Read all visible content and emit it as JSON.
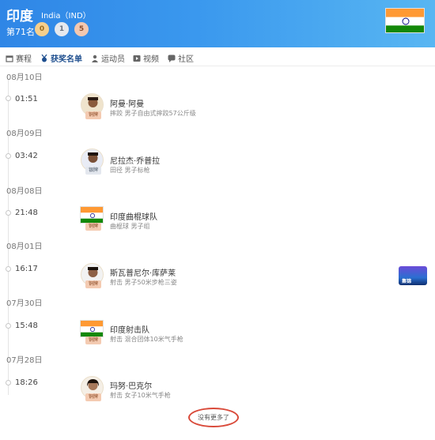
{
  "header": {
    "country_name": "印度",
    "country_code": "India（IND）",
    "rank": "第71名",
    "gold": "0",
    "silver": "1",
    "bronze": "5",
    "flag_colors": [
      "#ff9933",
      "#ffffff",
      "#138808"
    ]
  },
  "tabs": [
    {
      "label": "赛程",
      "icon": "calendar-icon"
    },
    {
      "label": "获奖名单",
      "icon": "medal-icon",
      "active": true
    },
    {
      "label": "运动员",
      "icon": "person-icon"
    },
    {
      "label": "视频",
      "icon": "video-icon"
    },
    {
      "label": "社区",
      "icon": "chat-icon"
    }
  ],
  "entries": [
    {
      "date": "08月10日",
      "time": "01:51",
      "name": "阿曼·阿曼",
      "event": "摔跤 男子自由式摔跤57公斤级",
      "medal": "铜牌",
      "avatar": "athlete"
    },
    {
      "date": "08月09日",
      "time": "03:42",
      "name": "尼拉杰·乔普拉",
      "event": "田径 男子标枪",
      "medal": "银牌",
      "avatar": "athlete"
    },
    {
      "date": "08月08日",
      "time": "21:48",
      "name": "印度曲棍球队",
      "event": "曲棍球 男子组",
      "medal": "铜牌",
      "avatar": "flag"
    },
    {
      "date": "08月01日",
      "time": "16:17",
      "name": "斯瓦普尼尔·库萨莱",
      "event": "射击 男子50米步枪三姿",
      "medal": "铜牌",
      "avatar": "athlete"
    },
    {
      "date": "07月30日",
      "time": "15:48",
      "name": "印度射击队",
      "event": "射击 混合团体10米气手枪",
      "medal": "铜牌",
      "avatar": "flag"
    },
    {
      "date": "07月28日",
      "time": "18:26",
      "name": "玛努·巴克尔",
      "event": "射击 女子10米气手枪",
      "medal": "铜牌",
      "avatar": "athlete"
    }
  ],
  "side_thumb_label": "集锦",
  "footer": {
    "no_more": "没有更多了"
  },
  "accent_color": "#d94a3a"
}
